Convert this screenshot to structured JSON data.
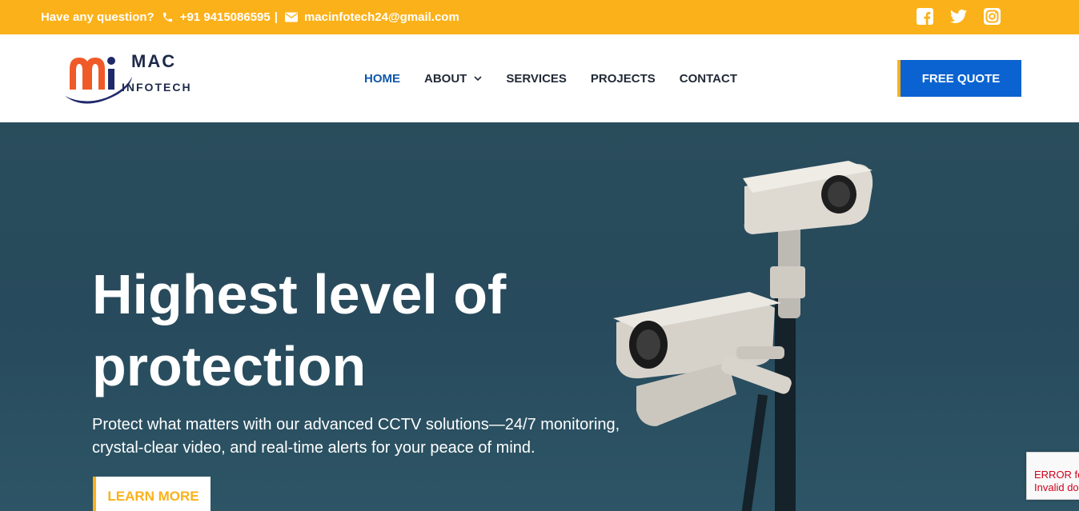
{
  "topbar": {
    "question": "Have any question?",
    "phone": "+91 9415086595",
    "separator": "|",
    "email": "macinfotech24@gmail.com",
    "social_icons": [
      "facebook-icon",
      "twitter-icon",
      "instagram-icon"
    ]
  },
  "logo": {
    "mac": "MAC",
    "infotech": "INFOTECH"
  },
  "nav": {
    "items": [
      {
        "label": "HOME",
        "active": true
      },
      {
        "label": "ABOUT",
        "has_dropdown": true
      },
      {
        "label": "SERVICES"
      },
      {
        "label": "PROJECTS"
      },
      {
        "label": "CONTACT"
      }
    ],
    "cta": "FREE QUOTE"
  },
  "hero": {
    "title": "Highest level of protection",
    "subtitle": "Protect what matters with our advanced CCTV solutions—24/7 monitoring, crystal-clear video, and real-time alerts for your peace of mind.",
    "button": "LEARN MORE"
  },
  "recaptcha": {
    "line1": "ERROR fo",
    "line2": "Invalid do"
  },
  "colors": {
    "accent_yellow": "#fbb119",
    "primary_blue": "#0b63d1",
    "hero_bg": "#274a5c",
    "nav_active": "#1058a8"
  }
}
